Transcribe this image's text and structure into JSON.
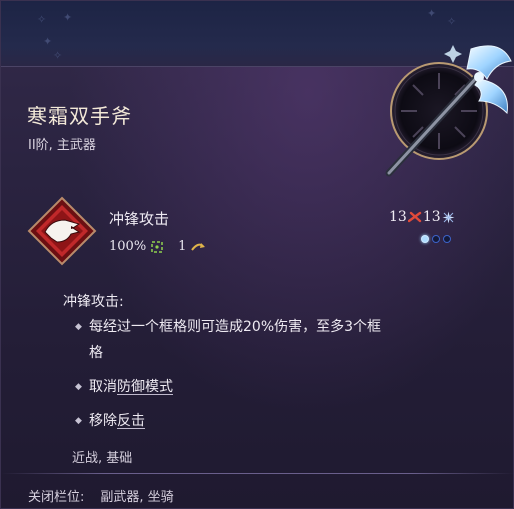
{
  "item": {
    "name": "寒霜双手斧",
    "subtitle": "II阶, 主武器"
  },
  "skill": {
    "name": "冲锋攻击",
    "accuracy": "100%",
    "accuracy_icon": "crosshair-icon",
    "range": "1",
    "range_icon": "movement-arrow-icon",
    "cost_primary": "13",
    "cost_primary_icon": "red-slash-icon",
    "cost_secondary": "13",
    "cost_secondary_icon": "frost-star-icon",
    "pips_filled": 1,
    "pips_total": 3
  },
  "description": {
    "heading": "冲锋攻击:",
    "bullet1_line1": "每经过一个框格则可造成20%伤害，至多3个框",
    "bullet1_line2": "格",
    "bullet2_prefix": "取消",
    "bullet2_keyword": "防御模式",
    "bullet3_prefix": "移除",
    "bullet3_keyword": "反击",
    "tags": "近战, 基础"
  },
  "footer": {
    "label": "关闭栏位:",
    "value": "副武器, 坐骑"
  },
  "colors": {
    "accent_red": "#c0282a",
    "accent_frost": "#9fd4ff",
    "pip_blue": "#3d63c9"
  }
}
